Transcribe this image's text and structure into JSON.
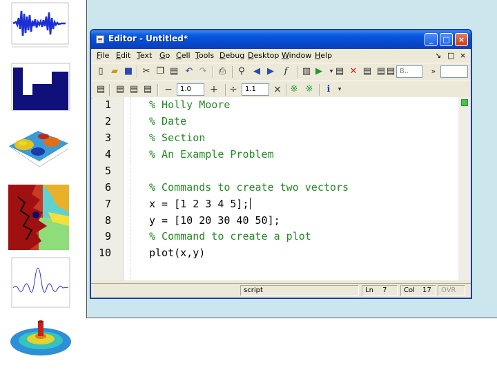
{
  "window": {
    "title": "Editor - Untitled*",
    "controls": {
      "minimize": "_",
      "maximize": "□",
      "close": "×"
    }
  },
  "menu": {
    "items": [
      "File",
      "Edit",
      "Text",
      "Go",
      "Cell",
      "Tools",
      "Debug",
      "Desktop",
      "Window",
      "Help"
    ],
    "right_icons": [
      "↘",
      "□",
      "×"
    ]
  },
  "toolbar": {
    "stack_field": "B..",
    "cell_minus": "−",
    "cell_value_a": "1.0",
    "cell_plus": "+",
    "cell_divide": "÷",
    "cell_value_b": "1.1",
    "cell_times": "×",
    "more": "»"
  },
  "editor": {
    "lines": [
      {
        "num": "1",
        "text": "% Holly Moore",
        "kind": "comment"
      },
      {
        "num": "2",
        "text": "% Date",
        "kind": "comment"
      },
      {
        "num": "3",
        "text": "% Section",
        "kind": "comment"
      },
      {
        "num": "4",
        "text": "% An Example Problem",
        "kind": "comment"
      },
      {
        "num": "5",
        "text": "",
        "kind": "blank"
      },
      {
        "num": "6",
        "text": "% Commands to create two vectors",
        "kind": "comment"
      },
      {
        "num": "7",
        "text": "x = [1 2 3 4 5];",
        "kind": "code"
      },
      {
        "num": "8",
        "text": "y = [10 20 30 40 50];",
        "kind": "code"
      },
      {
        "num": "9",
        "text": "% Command to create a plot",
        "kind": "comment"
      },
      {
        "num": "10",
        "text": "plot(x,y)",
        "kind": "code"
      }
    ]
  },
  "status": {
    "mode": "script",
    "ln_label": "Ln",
    "ln_value": "7",
    "col_label": "Col",
    "col_value": "17",
    "ovr": "OVR"
  },
  "colors": {
    "comment": "#228b22",
    "code": "#000000",
    "slide_background": "#cbe6ec",
    "titlebar": "#0548cc"
  }
}
